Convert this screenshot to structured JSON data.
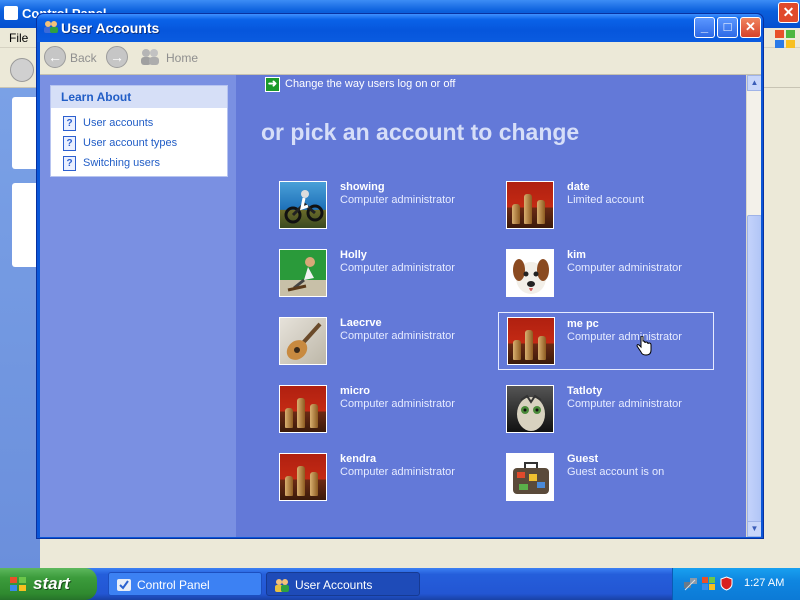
{
  "background_window": {
    "title": "Control Panel",
    "menu_file": "File"
  },
  "window": {
    "title": "User Accounts",
    "controls": {
      "minimize": "_",
      "maximize": "□",
      "close": "✕"
    }
  },
  "nav": {
    "back_label": "Back",
    "home_label": "Home"
  },
  "learn_about": {
    "title": "Learn About",
    "items": [
      {
        "label": "User accounts"
      },
      {
        "label": "User account types"
      },
      {
        "label": "Switching users"
      }
    ]
  },
  "change_link": {
    "label": "Change the way users log on or off"
  },
  "heading": "or pick an account to change",
  "accounts": [
    {
      "name": "showing",
      "type": "Computer administrator",
      "picture": "motocross-rider"
    },
    {
      "name": "date",
      "type": "Limited account",
      "picture": "chess-pieces"
    },
    {
      "name": "Holly",
      "type": "Computer administrator",
      "picture": "skateboarder"
    },
    {
      "name": "kim",
      "type": "Computer administrator",
      "picture": "dog"
    },
    {
      "name": "Laecrve",
      "type": "Computer administrator",
      "picture": "guitar"
    },
    {
      "name": "me pc",
      "type": "Computer administrator",
      "picture": "chess-pieces",
      "selected": true
    },
    {
      "name": "micro",
      "type": "Computer administrator",
      "picture": "chess-pieces"
    },
    {
      "name": "Tatloty",
      "type": "Computer administrator",
      "picture": "cat"
    },
    {
      "name": "kendra",
      "type": "Computer administrator",
      "picture": "chess-pieces"
    },
    {
      "name": "Guest",
      "type": "Guest account is on",
      "picture": "suitcase"
    }
  ],
  "taskbar": {
    "start_label": "start",
    "tasks": [
      {
        "label": "Control Panel",
        "active": false
      },
      {
        "label": "User Accounts",
        "active": true
      }
    ],
    "clock": "1:27 AM"
  },
  "colors": {
    "content_bg": "#6379d8",
    "title_bar": "#0a5be0",
    "start_green": "#3c9c3c"
  }
}
